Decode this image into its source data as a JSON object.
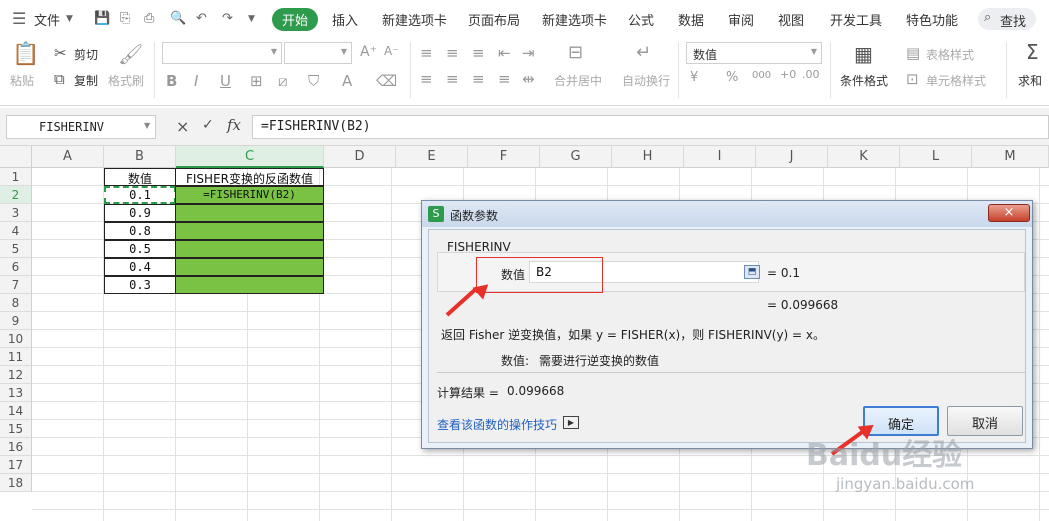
{
  "menubar": {
    "file": "文件",
    "tabs": [
      "开始",
      "插入",
      "新建选项卡",
      "页面布局",
      "新建选项卡",
      "公式",
      "数据",
      "审阅",
      "视图",
      "开发工具",
      "特色功能"
    ],
    "active_tab": "开始",
    "search": "查找"
  },
  "ribbon": {
    "cut": "剪切",
    "paste": "粘贴",
    "copy": "复制",
    "format_painter": "格式刷",
    "merge_center": "合并居中",
    "wrap_text": "自动换行",
    "number_format": "数值",
    "conditional_format": "条件格式",
    "table_style": "表格样式",
    "cell_style": "单元格样式",
    "sum": "求和",
    "font_size_up": "A⁺",
    "font_size_down": "A⁻",
    "bold": "B",
    "italic": "I",
    "underline": "U",
    "currency": "¥",
    "percent": "%",
    "thousands": "000"
  },
  "formula_bar": {
    "name_box": "FISHERINV",
    "cancel": "×",
    "confirm": "✓",
    "fx": "fx",
    "formula": "=FISHERINV(B2)"
  },
  "sheet": {
    "columns": [
      "A",
      "B",
      "C",
      "D",
      "E",
      "F",
      "G",
      "H",
      "I",
      "J",
      "K",
      "L",
      "M"
    ],
    "rows": [
      "1",
      "2",
      "3",
      "4",
      "5",
      "6",
      "7",
      "8",
      "9",
      "10",
      "11",
      "12",
      "13",
      "14",
      "15",
      "16",
      "17",
      "18"
    ],
    "header_b": "数值",
    "header_c": "FISHER变换的反函数值",
    "values": [
      "0.1",
      "0.9",
      "0.8",
      "0.5",
      "0.4",
      "0.3"
    ],
    "c2_formula": "=FISHERINV(B2)"
  },
  "dialog": {
    "title": "函数参数",
    "close": "×",
    "func_name": "FISHERINV",
    "arg_label": "数值",
    "arg_value": "B2",
    "arg_result": "= 0.1",
    "func_result": "= 0.099668",
    "description": "返回 Fisher 逆变换值，如果 y = FISHER(x)，则 FISHERINV(y) = x。",
    "arg_desc_label": "数值:",
    "arg_desc": "需要进行逆变换的数值",
    "calc_result_label": "计算结果 =",
    "calc_result_value": "0.099668",
    "help_link": "查看该函数的操作技巧",
    "ok": "确定",
    "cancel": "取消"
  },
  "watermark": {
    "brand": "Baidu经验",
    "url": "jingyan.baidu.com"
  },
  "colors": {
    "accent": "#2e9a4c",
    "cell_fill": "#7ac243",
    "annotation": "#e8302a",
    "link": "#1f5fbf"
  }
}
